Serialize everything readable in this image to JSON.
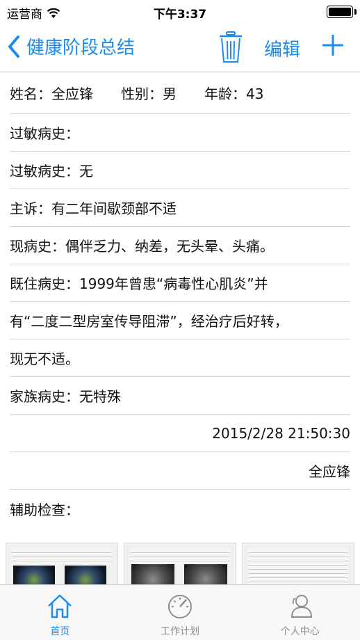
{
  "status_bar": {
    "carrier": "运营商",
    "time": "下午3:37",
    "battery_level": 1.0
  },
  "nav": {
    "back_label": "健康阶段总结",
    "edit_label": "编辑",
    "icons": [
      "chevron-left-icon",
      "trash-icon",
      "plus-icon"
    ],
    "accent_color": "#1a8cf2"
  },
  "patient": {
    "name_label": "姓名：",
    "name": "全应锋",
    "gender_label": "性别：",
    "gender": "男",
    "age_label": "年龄：",
    "age": "43"
  },
  "record": {
    "allergy_header": "过敏病史：",
    "allergy_label": "过敏病史：",
    "allergy_value": "无",
    "complaint_label": "主诉：",
    "complaint_value": "有二年间歇颈部不适",
    "present_label": "现病史：",
    "present_value": "偶伴乏力、纳差，无头晕、头痛。",
    "past_label": "既住病史：",
    "past_line1": "1999年曾患“病毒性心肌炎”并",
    "past_line2": "有“二度二型房室传导阻滞”，经治疗后好转，",
    "past_line3": "现无不适。",
    "family_label": "家族病史：",
    "family_value": "无特殊",
    "timestamp": "2015/2/28 21:50:30",
    "author": "全应锋",
    "aux_label": "辅助检查："
  },
  "tabs": [
    {
      "label": "首页",
      "icon": "home-icon",
      "active": true
    },
    {
      "label": "工作计划",
      "icon": "gauge-icon",
      "active": false
    },
    {
      "label": "个人中心",
      "icon": "user-icon",
      "active": false
    }
  ]
}
